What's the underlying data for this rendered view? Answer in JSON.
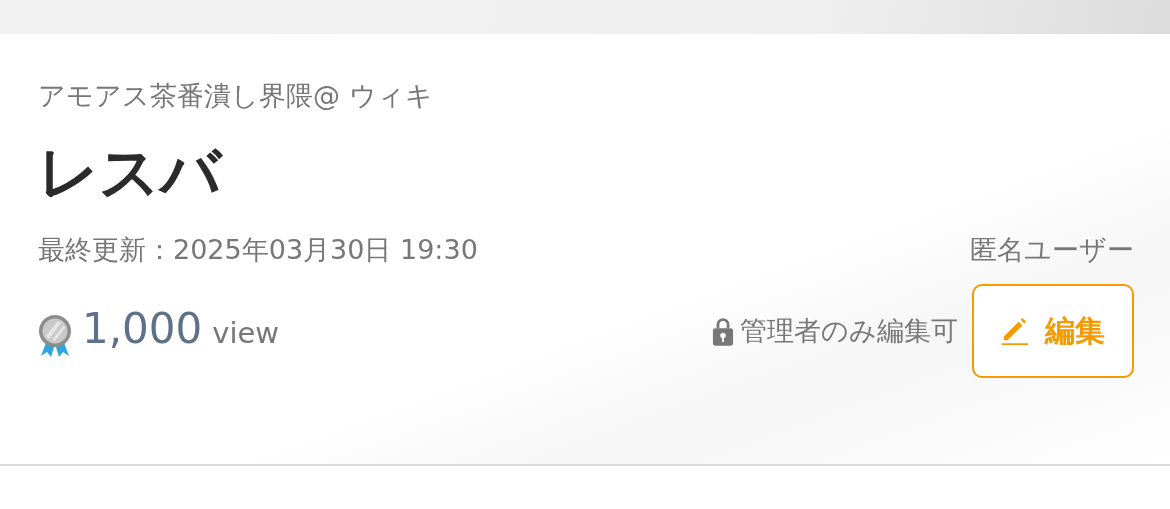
{
  "site_name": "アモアス茶番潰し界隈@ ウィキ",
  "page_title": "レスバ",
  "last_updated": "最終更新：2025年03月30日 19:30",
  "author": "匿名ユーザー",
  "views": {
    "count": "1,000",
    "unit": "view"
  },
  "edit_permission": {
    "locked": true,
    "label": "管理者のみ編集可"
  },
  "edit_button": {
    "label": "編集"
  }
}
